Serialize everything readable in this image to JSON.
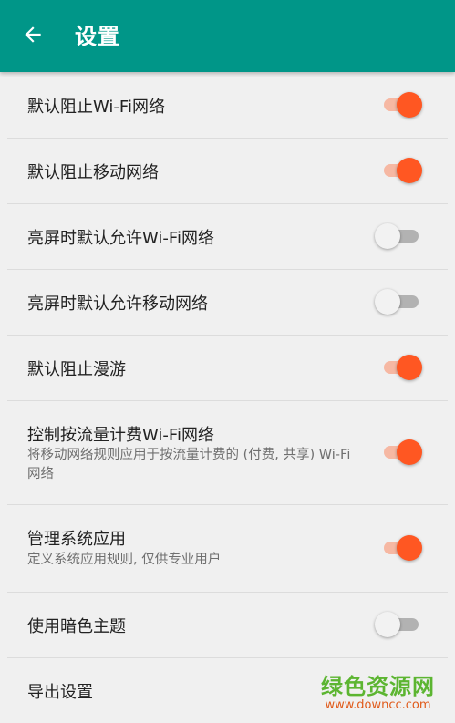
{
  "appbar": {
    "title": "设置",
    "back_icon": "arrow-left-icon",
    "color": "#009688"
  },
  "colors": {
    "switch_on_thumb": "#ff5722",
    "switch_on_track": "#f6b8a3",
    "switch_off_thumb": "#f2f2f2",
    "switch_off_track": "#b2b2b2"
  },
  "settings": [
    {
      "title": "默认阻止Wi-Fi网络",
      "summary": "",
      "checked": true
    },
    {
      "title": "默认阻止移动网络",
      "summary": "",
      "checked": true
    },
    {
      "title": "亮屏时默认允许Wi-Fi网络",
      "summary": "",
      "checked": false
    },
    {
      "title": "亮屏时默认允许移动网络",
      "summary": "",
      "checked": false
    },
    {
      "title": "默认阻止漫游",
      "summary": "",
      "checked": true
    },
    {
      "title": "控制按流量计费Wi-Fi网络",
      "summary": "将移动网络规则应用于按流量计费的 (付费, 共享) Wi-Fi网络",
      "checked": true
    },
    {
      "title": "管理系统应用",
      "summary": "定义系统应用规则, 仅供专业用户",
      "checked": true
    },
    {
      "title": "使用暗色主题",
      "summary": "",
      "checked": false
    },
    {
      "title": "导出设置",
      "summary": ""
    }
  ],
  "watermark": {
    "name": "绿色资源网",
    "url": "www.downcc.com"
  }
}
